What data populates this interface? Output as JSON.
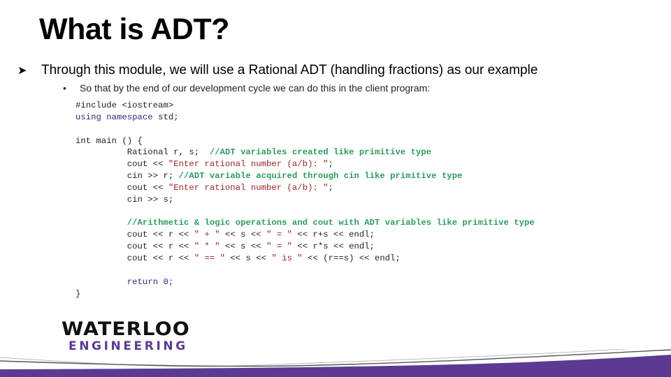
{
  "slide": {
    "title": "What is ADT?",
    "bullet_icon": "arrow-bullet-icon",
    "bullet1": "Through this module, we will use a Rational ADT (handling fractions) as our example",
    "bullet2": "So that by the end of our development cycle we can do this in the client program:",
    "code_lines": [
      [
        {
          "t": "#include <iostream>",
          "c": ""
        }
      ],
      [
        {
          "t": "using namespace ",
          "c": "kw"
        },
        {
          "t": "std;",
          "c": ""
        }
      ],
      [
        {
          "t": "",
          "c": ""
        }
      ],
      [
        {
          "t": "int main () {",
          "c": ""
        }
      ],
      [
        {
          "t": "          Rational r, s;  ",
          "c": ""
        },
        {
          "t": "//ADT variables created like primitive type",
          "c": "cmt"
        }
      ],
      [
        {
          "t": "          cout << ",
          "c": ""
        },
        {
          "t": "\"Enter rational number (a/b): \"",
          "c": "str"
        },
        {
          "t": ";",
          "c": ""
        }
      ],
      [
        {
          "t": "          cin >> r; ",
          "c": ""
        },
        {
          "t": "//ADT variable acquired through cin like primitive type",
          "c": "cmt"
        }
      ],
      [
        {
          "t": "          cout << ",
          "c": ""
        },
        {
          "t": "\"Enter rational number (a/b): \"",
          "c": "str"
        },
        {
          "t": ";",
          "c": ""
        }
      ],
      [
        {
          "t": "          cin >> s;",
          "c": ""
        }
      ],
      [
        {
          "t": "",
          "c": ""
        }
      ],
      [
        {
          "t": "          ",
          "c": ""
        },
        {
          "t": "//Arithmetic & logic operations and cout with ADT variables like primitive type",
          "c": "cmt"
        }
      ],
      [
        {
          "t": "          cout << r << ",
          "c": ""
        },
        {
          "t": "\" + \"",
          "c": "str"
        },
        {
          "t": " << s << ",
          "c": ""
        },
        {
          "t": "\" = \"",
          "c": "str"
        },
        {
          "t": " << r+s << endl;",
          "c": ""
        }
      ],
      [
        {
          "t": "          cout << r << ",
          "c": ""
        },
        {
          "t": "\" * \"",
          "c": "str"
        },
        {
          "t": " << s << ",
          "c": ""
        },
        {
          "t": "\" = \"",
          "c": "str"
        },
        {
          "t": " << r*s << endl;",
          "c": ""
        }
      ],
      [
        {
          "t": "          cout << r << ",
          "c": ""
        },
        {
          "t": "\" == \"",
          "c": "str"
        },
        {
          "t": " << s << ",
          "c": ""
        },
        {
          "t": "\" is \"",
          "c": "str"
        },
        {
          "t": " << (r==s) << endl;",
          "c": ""
        }
      ],
      [
        {
          "t": "",
          "c": ""
        }
      ],
      [
        {
          "t": "          ",
          "c": ""
        },
        {
          "t": "return 0;",
          "c": "kw"
        }
      ],
      [
        {
          "t": "}",
          "c": ""
        }
      ]
    ]
  },
  "logo": {
    "line1": "WATERLOO",
    "line2": "ENGINEERING"
  },
  "colors": {
    "brand_purple": "#5b3a93",
    "comment_green": "#2e9b5e",
    "string_red": "#9b2323",
    "keyword_blue": "#2a2a7a"
  }
}
